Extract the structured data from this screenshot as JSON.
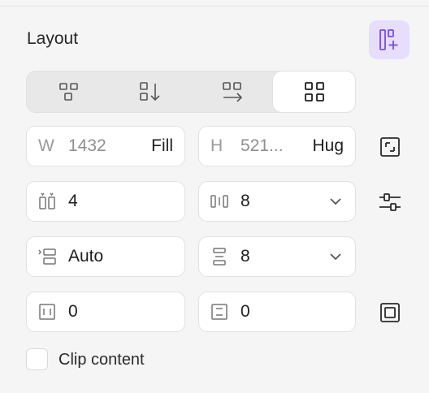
{
  "panel": {
    "title": "Layout"
  },
  "modes": [
    {
      "name": "freeform",
      "icon": "freeform-layout-icon"
    },
    {
      "name": "vertical",
      "icon": "vertical-stack-icon"
    },
    {
      "name": "horizontal",
      "icon": "horizontal-stack-icon"
    },
    {
      "name": "grid",
      "icon": "grid-layout-icon",
      "selected": true
    }
  ],
  "size": {
    "width": {
      "label": "W",
      "value": "1432",
      "mode": "Fill"
    },
    "height": {
      "label": "H",
      "value": "521...",
      "mode": "Hug"
    }
  },
  "grid": {
    "columns": "4",
    "column_gap": "8",
    "rows": "Auto",
    "row_gap": "8",
    "padding_horizontal": "0",
    "padding_vertical": "0"
  },
  "clip": {
    "label": "Clip content",
    "checked": false
  },
  "colors": {
    "accent_bg": "#e7ddfd",
    "accent_icon": "#7b4ae2"
  }
}
